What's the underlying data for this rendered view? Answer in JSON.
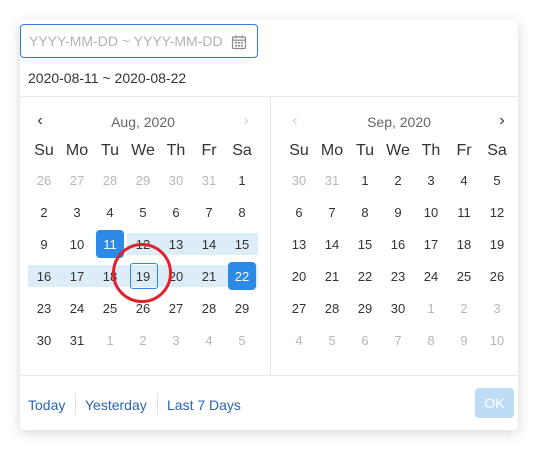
{
  "range_input": {
    "placeholder": "YYYY-MM-DD ~ YYYY-MM-DD",
    "icon": "calendar-icon"
  },
  "selected_range_text": "2020-08-11 ~ 2020-08-22",
  "weekdays": [
    "Su",
    "Mo",
    "Tu",
    "We",
    "Th",
    "Fr",
    "Sa"
  ],
  "left_calendar": {
    "title": "Aug, 2020",
    "prev_icon": "chevron-left-icon",
    "next_icon": "chevron-right-icon",
    "weeks": [
      [
        "26",
        "27",
        "28",
        "29",
        "30",
        "31",
        "1"
      ],
      [
        "2",
        "3",
        "4",
        "5",
        "6",
        "7",
        "8"
      ],
      [
        "9",
        "10",
        "11",
        "12",
        "13",
        "14",
        "15"
      ],
      [
        "16",
        "17",
        "18",
        "19",
        "20",
        "21",
        "22"
      ],
      [
        "23",
        "24",
        "25",
        "26",
        "27",
        "28",
        "29"
      ],
      [
        "30",
        "31",
        "1",
        "2",
        "3",
        "4",
        "5"
      ]
    ]
  },
  "right_calendar": {
    "title": "Sep, 2020",
    "prev_icon": "chevron-left-icon",
    "next_icon": "chevron-right-icon",
    "weeks": [
      [
        "30",
        "31",
        "1",
        "2",
        "3",
        "4",
        "5"
      ],
      [
        "6",
        "7",
        "8",
        "9",
        "10",
        "11",
        "12"
      ],
      [
        "13",
        "14",
        "15",
        "16",
        "17",
        "18",
        "19"
      ],
      [
        "20",
        "21",
        "22",
        "23",
        "24",
        "25",
        "26"
      ],
      [
        "27",
        "28",
        "29",
        "30",
        "1",
        "2",
        "3"
      ],
      [
        "4",
        "5",
        "6",
        "7",
        "8",
        "9",
        "10"
      ]
    ]
  },
  "shortcuts": [
    "Today",
    "Yesterday",
    "Last 7 Days"
  ],
  "ok_label": "OK",
  "colors": {
    "accent": "#2a8ae6",
    "range_band": "#ddecf9",
    "annotation": "#e0202a"
  }
}
